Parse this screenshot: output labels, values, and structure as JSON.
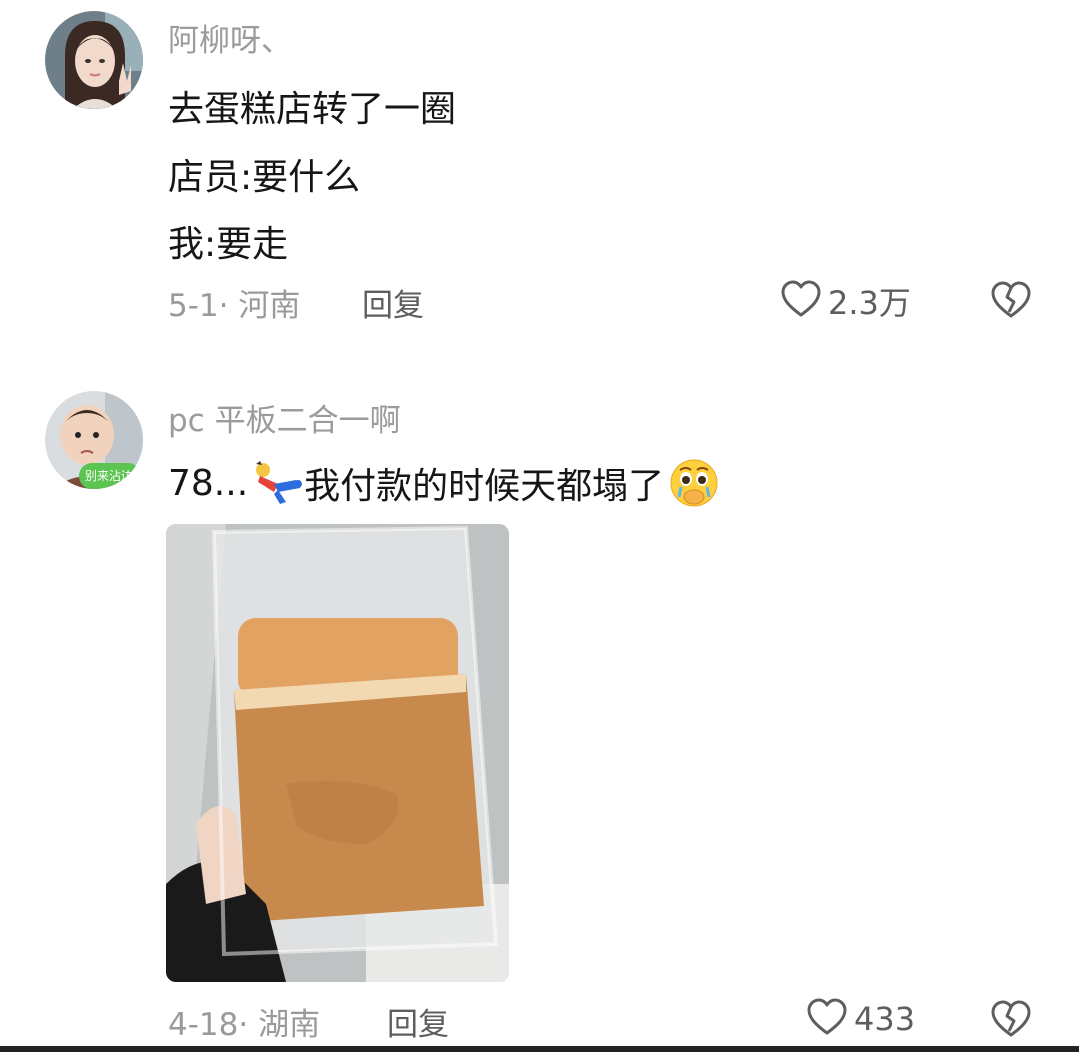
{
  "comments": [
    {
      "username": "阿柳呀、",
      "lines": [
        "去蛋糕店转了一圈",
        "店员:要什么",
        "我:要走"
      ],
      "date_location": "5-1· 河南",
      "reply_label": "回复",
      "like_count": "2.3万"
    },
    {
      "username": "pc 平板二合一啊",
      "text_prefix": "78...",
      "text_main": "我付款的时候天都塌了",
      "avatar_caption": "别来沾边",
      "date_location": "4-18· 湖南",
      "reply_label": "回复",
      "like_count": "433"
    }
  ],
  "icons": {
    "like": "heart-outline-icon",
    "dislike": "broken-heart-icon",
    "emoji_fall": "falling-person-emoji",
    "emoji_cry": "pleading-crying-emoji"
  },
  "colors": {
    "text": "#161616",
    "secondary": "#9b9b9b",
    "action": "#5e5e5e"
  }
}
